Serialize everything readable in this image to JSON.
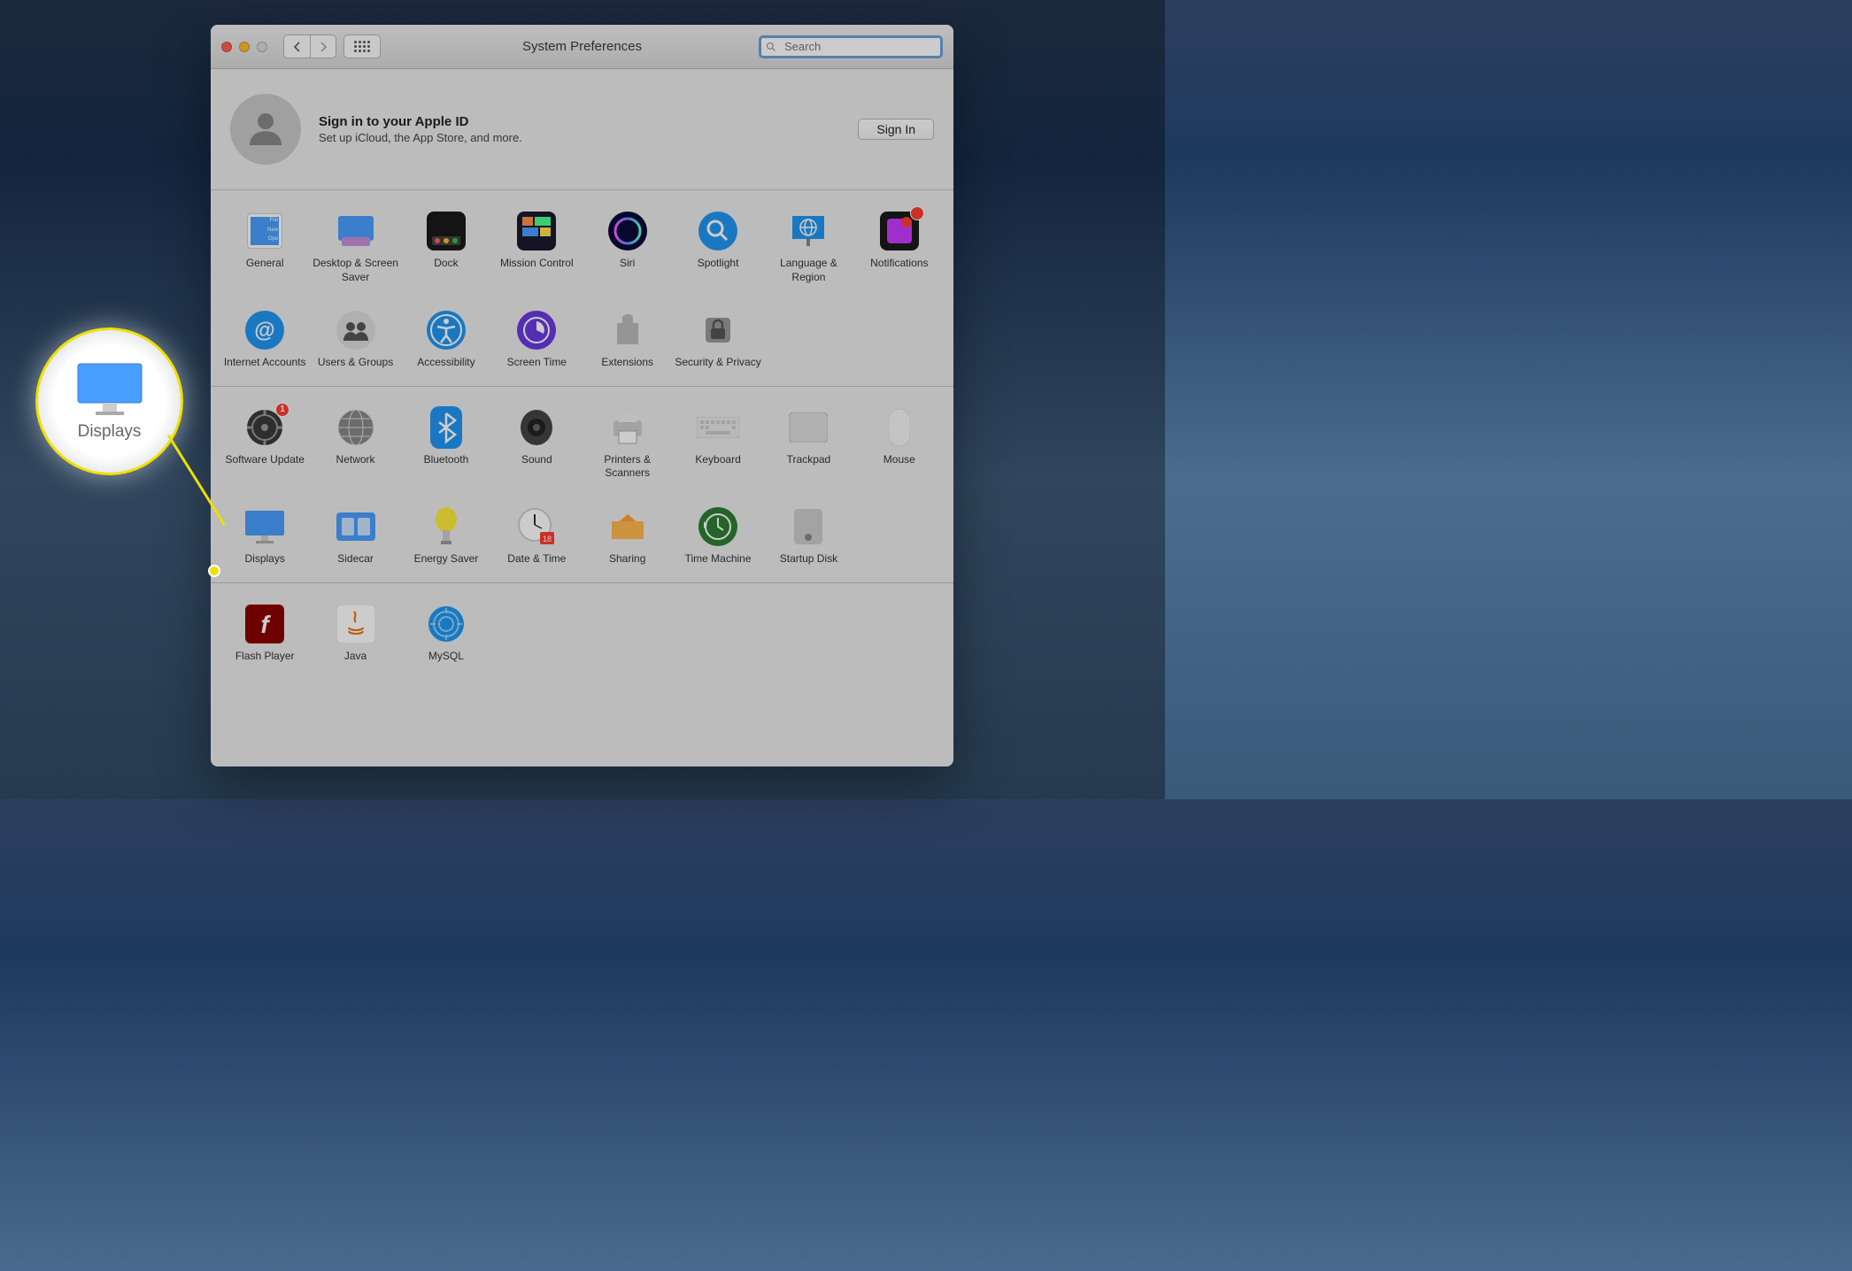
{
  "window": {
    "title": "System Preferences",
    "search_placeholder": "Search"
  },
  "apple_id": {
    "heading": "Sign in to your Apple ID",
    "sub": "Set up iCloud, the App Store, and more.",
    "button": "Sign In"
  },
  "rows": [
    [
      {
        "label": "General",
        "icon": "general"
      },
      {
        "label": "Desktop & Screen Saver",
        "icon": "desktop"
      },
      {
        "label": "Dock",
        "icon": "dock"
      },
      {
        "label": "Mission Control",
        "icon": "mission"
      },
      {
        "label": "Siri",
        "icon": "siri"
      },
      {
        "label": "Spotlight",
        "icon": "spotlight"
      },
      {
        "label": "Language & Region",
        "icon": "language"
      },
      {
        "label": "Notifications",
        "icon": "notif",
        "badge": ""
      }
    ],
    [
      {
        "label": "Internet Accounts",
        "icon": "internet"
      },
      {
        "label": "Users & Groups",
        "icon": "users"
      },
      {
        "label": "Accessibility",
        "icon": "access"
      },
      {
        "label": "Screen Time",
        "icon": "screentime"
      },
      {
        "label": "Extensions",
        "icon": "ext"
      },
      {
        "label": "Security & Privacy",
        "icon": "security"
      }
    ]
  ],
  "rows2": [
    [
      {
        "label": "Software Update",
        "icon": "software",
        "badge": "1"
      },
      {
        "label": "Network",
        "icon": "network"
      },
      {
        "label": "Bluetooth",
        "icon": "bluetooth"
      },
      {
        "label": "Sound",
        "icon": "sound"
      },
      {
        "label": "Printers & Scanners",
        "icon": "printers"
      },
      {
        "label": "Keyboard",
        "icon": "keyboard"
      },
      {
        "label": "Trackpad",
        "icon": "trackpad"
      },
      {
        "label": "Mouse",
        "icon": "mouse"
      }
    ],
    [
      {
        "label": "Displays",
        "icon": "displays"
      },
      {
        "label": "Sidecar",
        "icon": "sidecar"
      },
      {
        "label": "Energy Saver",
        "icon": "energy"
      },
      {
        "label": "Date & Time",
        "icon": "datetime"
      },
      {
        "label": "Sharing",
        "icon": "sharing"
      },
      {
        "label": "Time Machine",
        "icon": "timemachine"
      },
      {
        "label": "Startup Disk",
        "icon": "startup"
      }
    ]
  ],
  "rows3": [
    {
      "label": "Flash Player",
      "icon": "flash"
    },
    {
      "label": "Java",
      "icon": "java"
    },
    {
      "label": "MySQL",
      "icon": "mysql"
    }
  ],
  "callout": {
    "label": "Displays"
  }
}
